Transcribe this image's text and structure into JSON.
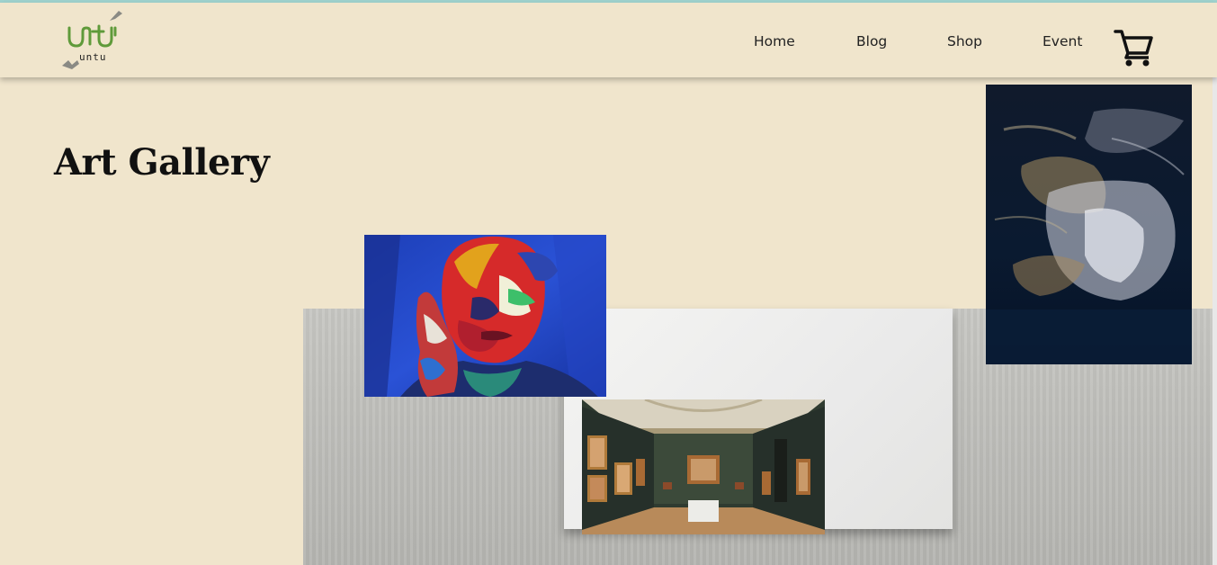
{
  "logo": {
    "text": "untu",
    "icon": "untu-logo-icon"
  },
  "nav": {
    "items": [
      {
        "label": "Home"
      },
      {
        "label": "Blog"
      },
      {
        "label": "Shop"
      },
      {
        "label": "Event"
      }
    ],
    "cart_icon": "shopping-cart-icon"
  },
  "page": {
    "title": "Art Gallery"
  },
  "colors": {
    "background": "#f0e5cc",
    "accent_strip": "#9fd3cf",
    "logo_green": "#5f9a3a",
    "text": "#222222"
  }
}
